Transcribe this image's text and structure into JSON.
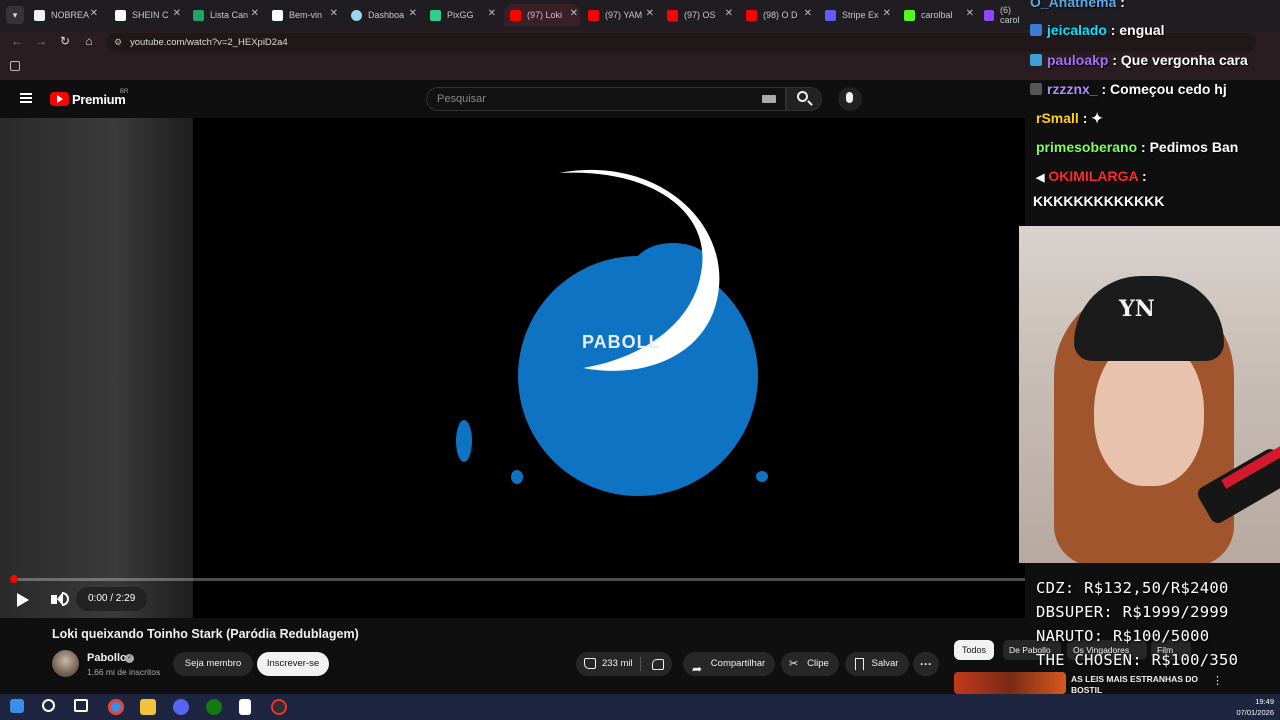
{
  "browser": {
    "tabs": [
      {
        "label": "NOBREA",
        "favicon_color": "#f0f0f0"
      },
      {
        "label": "SHEIN C",
        "favicon_color": "#ffffff"
      },
      {
        "label": "Lista Can",
        "favicon_color": "#1fa463"
      },
      {
        "label": "Bem-vin",
        "favicon_color": "#ffffff"
      },
      {
        "label": "Dashboa",
        "favicon_color": "#9fd4f0"
      },
      {
        "label": "PixGG",
        "favicon_color": "#2fd18a"
      },
      {
        "label": "(97) Loki",
        "favicon_color": "#ff0000"
      },
      {
        "label": "(97) YAM",
        "favicon_color": "#ff0000"
      },
      {
        "label": "(97) OS",
        "favicon_color": "#ff0000"
      },
      {
        "label": "(98) O D",
        "favicon_color": "#ff0000"
      },
      {
        "label": "Stripe Ex",
        "favicon_color": "#635bff"
      },
      {
        "label": "carolbal",
        "favicon_color": "#53fc18"
      },
      {
        "label": "(6) carol",
        "favicon_color": "#9146ff"
      }
    ],
    "url": "youtube.com/watch?v=2_HEXpiD2a4"
  },
  "youtube": {
    "logo_label": "Premium",
    "region": "BR",
    "search_placeholder": "Pesquisar"
  },
  "video": {
    "title": "Loki queixando Toinho Stark (Paródia Redublagem)",
    "logo_text": "PABOLL",
    "time": "0:00 / 2:29",
    "progress": 0.0
  },
  "channel": {
    "name": "Pabollo",
    "verified_mark": "✓",
    "subscribers": "1,66 mi de inscritos",
    "member_label": "Seja membro",
    "subscribe_label": "Inscrever-se"
  },
  "actions": {
    "likes": "233 mil",
    "share_label": "Compartilhar",
    "clip_label": "Clipe",
    "save_label": "Salvar",
    "more_label": "···"
  },
  "sidebar": {
    "chips": [
      "Todos",
      "De Pabollo",
      "Os Vingadores",
      "Film"
    ],
    "recommended_title": "AS LEIS MAIS ESTRANHAS DO BOSTIL"
  },
  "stream_chat": [
    {
      "user": "O_Anathema",
      "message": "",
      "color": "#5aa9e6"
    },
    {
      "user": "jeicalado",
      "message": "engual",
      "color": "#00e5ff"
    },
    {
      "user": "pauloakp",
      "message": "Que vergonha cara",
      "color": "#a86cff"
    },
    {
      "user": "rzzznx_",
      "message": "Começou cedo hj",
      "color": "#b18cff"
    },
    {
      "user": "rSmall",
      "message": "",
      "color": "#ffd400"
    },
    {
      "user": "primesoberano",
      "message": "Pedimos Ban",
      "color": "#7fff5a"
    },
    {
      "user": "OKIMILARGA",
      "message": "KKKKKKKKKKKKK",
      "color": "#ff2a2a"
    }
  ],
  "webcam": {
    "cap_logo": "YN"
  },
  "prices": [
    "CDZ: R$132,50/R$2400",
    "DBSUPER: R$1999/2999",
    "NARUTO: R$100/5000",
    "THE CHOSEN: R$100/350"
  ],
  "taskbar": {
    "time": "19:49",
    "date": "07/01/2026"
  }
}
